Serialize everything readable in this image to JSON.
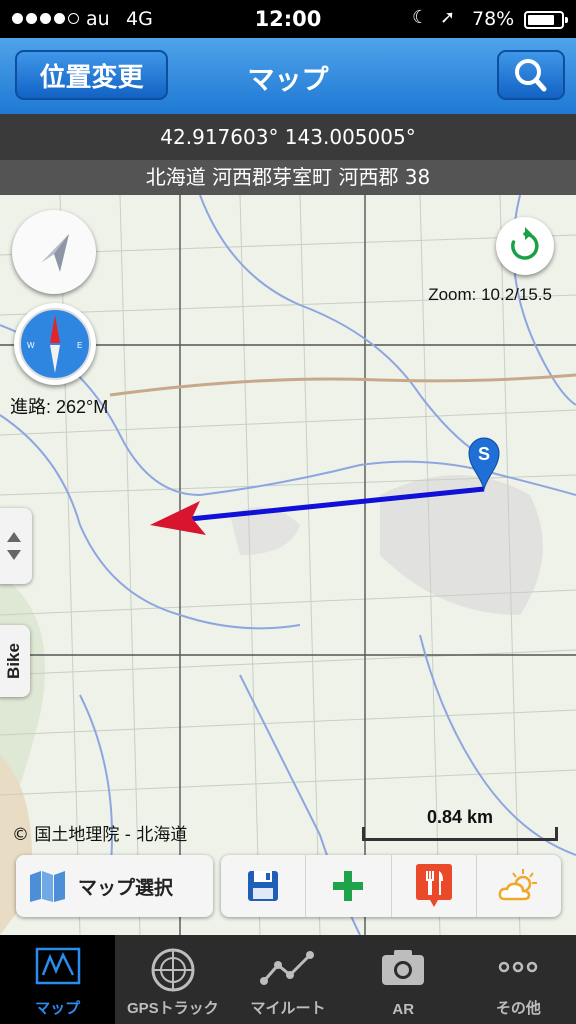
{
  "status_bar": {
    "carrier": "au",
    "network": "4G",
    "time": "12:00",
    "battery": "78%"
  },
  "nav": {
    "location_button": "位置変更",
    "title": "マップ"
  },
  "info": {
    "coordinates": "42.917603° 143.005005°",
    "address": "北海道 河西郡芽室町 河西郡 38"
  },
  "map": {
    "zoom": "Zoom: 10.2/15.5",
    "course": "進路: 262°M",
    "bike_label": "Bike",
    "copyright": "© 国土地理院 - 北海道",
    "scale": "0.84 km",
    "start_marker": "S"
  },
  "toolbar": {
    "map_select": "マップ選択"
  },
  "tabs": [
    {
      "label": "マップ"
    },
    {
      "label": "GPSトラック"
    },
    {
      "label": "マイルート"
    },
    {
      "label": "AR"
    },
    {
      "label": "その他"
    }
  ],
  "colors": {
    "nav_blue": "#1f79d4",
    "route_blue": "#1010d8",
    "arrow_red": "#d9142f",
    "tab_active": "#2a8cf0"
  }
}
